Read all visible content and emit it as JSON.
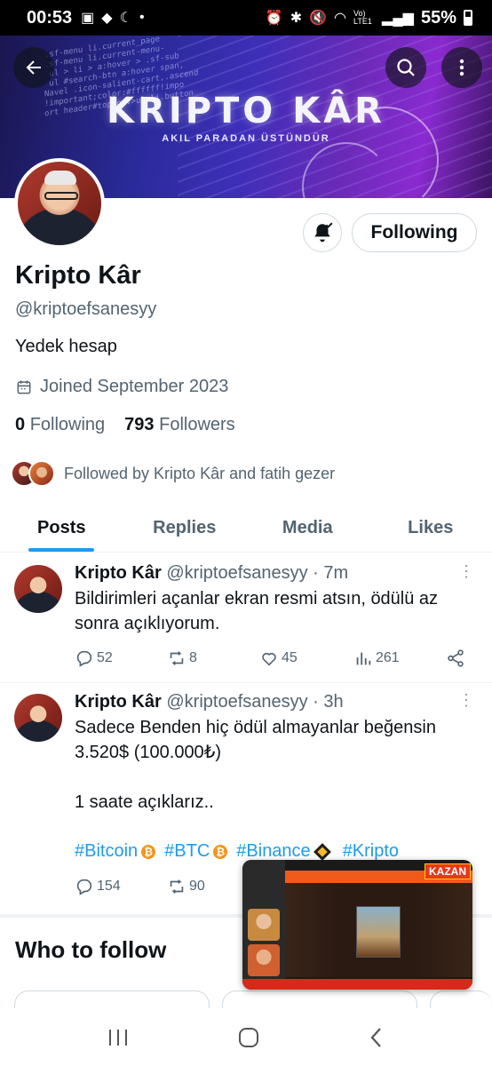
{
  "status_bar": {
    "time": "00:53",
    "network_label": "Vo) LTE1",
    "battery": "55%"
  },
  "banner": {
    "brand": "KRIPTO KÂR",
    "tagline": "AKIL PARADAN ÜSTÜNDÜR",
    "code_lines": ".sf-menu li.current_page\n.sf-menu li.current-menu-\n ul > li > a:hover > .sf-sub\n ul #search-btn a:hover span,\nNavel .icon-salient-cart,.ascend\n!important;color:#ffffff!impo\nort header#top nav>ul>li.button"
  },
  "profile": {
    "display_name": "Kripto Kâr",
    "handle": "@kriptoefsanesyy",
    "bio": "Yedek hesap",
    "joined": "Joined September 2023",
    "following_count": "0",
    "following_label": "Following",
    "followers_count": "793",
    "followers_label": "Followers",
    "followed_by": "Followed by Kripto Kâr and fatih gezer",
    "follow_button": "Following"
  },
  "tabs": [
    {
      "label": "Posts",
      "active": true
    },
    {
      "label": "Replies",
      "active": false
    },
    {
      "label": "Media",
      "active": false
    },
    {
      "label": "Likes",
      "active": false
    }
  ],
  "posts": [
    {
      "name": "Kripto Kâr",
      "meta": "@kriptoefsanesyy · 7m",
      "text": "Bildirimleri açanlar ekran resmi atsın, ödülü az sonra açıklıyorum.",
      "replies": "52",
      "reposts": "8",
      "likes": "45",
      "views": "261"
    },
    {
      "name": "Kripto Kâr",
      "meta": "@kriptoefsanesyy · 3h",
      "text": "Sadece Benden hiç ödül almayanlar beğensin\n3.520$ (100.000₺)\n\n1 saate açıklarız..",
      "hashtags": [
        "#Bitcoin",
        "#BTC",
        "#Binance",
        "#Kripto"
      ],
      "replies": "154",
      "reposts": "90"
    }
  ],
  "who_to_follow": "Who to follow",
  "pip": {
    "badge": "KAZAN"
  },
  "colors": {
    "accent": "#1d9bf0",
    "secondary_text": "#536471",
    "primary_text": "#0f1419"
  }
}
